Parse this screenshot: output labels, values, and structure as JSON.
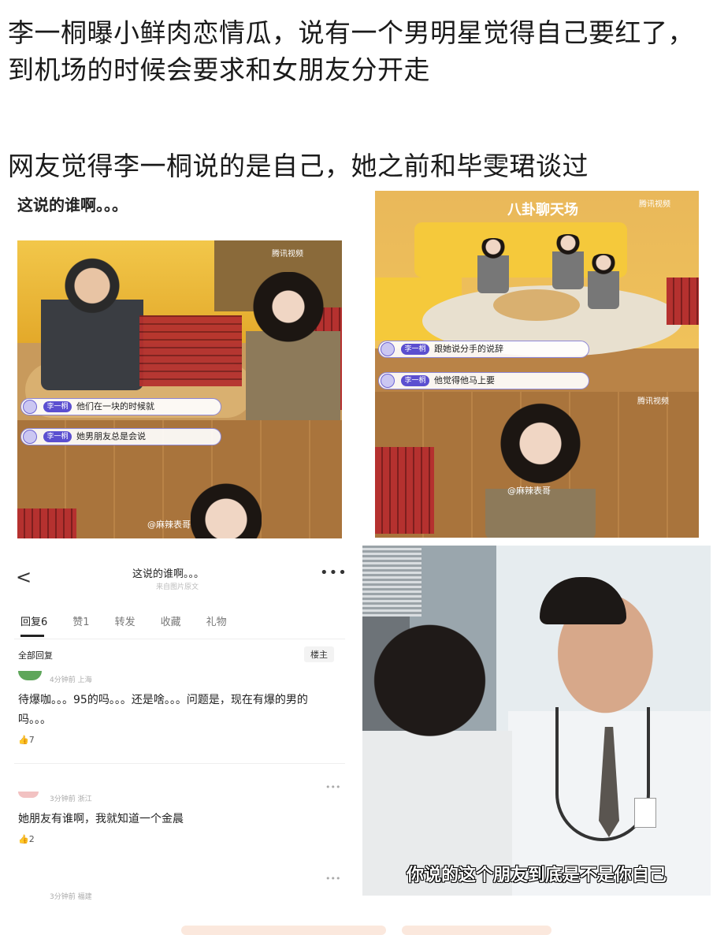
{
  "post": {
    "headline_line1": "李一桐曝小鲜肉恋情瓜，说有一个男明星觉得自己要红了，到机场的时候会要求和女朋友分开走",
    "headline_line2": "网友觉得李一桐说的是自己，她之前和毕雯珺谈过"
  },
  "shot_a": {
    "caption": "这说的谁啊。。。",
    "logo": "腾讯视频",
    "subtitle1_tag": "李一桐",
    "subtitle1_text": "他们在一块的时候就",
    "subtitle2_tag": "李一桐",
    "subtitle2_text": "她男朋友总是会说",
    "watermark": "@麻辣表哥"
  },
  "shot_b": {
    "show_title": "八卦聊天场",
    "logo": "腾讯视频",
    "subtitle1_tag": "李一桐",
    "subtitle1_text": "跟她说分手的说辞",
    "subtitle2_tag": "李一桐",
    "subtitle2_text": "他觉得他马上要",
    "watermark": "@麻辣表哥",
    "watermark2": "腾讯视频"
  },
  "shot_c": {
    "back": "<",
    "title": "这说的谁啊。。。",
    "subtitle": "来自图片原文",
    "more": "•••",
    "tabs": [
      "回复6",
      "赞1",
      "转发",
      "收藏",
      "礼物"
    ],
    "all_replies": "全部回复",
    "op_label": "楼主",
    "comments": [
      {
        "meta": "4分钟前 上海",
        "text": "待爆咖。。。95的吗。。。还是啥。。。问题是，现在有爆的男的吗。。。",
        "likes": "7"
      },
      {
        "meta": "3分钟前 浙江",
        "text": "她朋友有谁啊，我就知道一个金晨",
        "likes": "2"
      },
      {
        "meta": "3分钟前 福建",
        "text": "",
        "likes": ""
      }
    ],
    "dots": "•••"
  },
  "shot_d": {
    "subtitle": "你说的这个朋友到底是不是你自己"
  },
  "icons": {
    "like": "thumbs-up-icon",
    "back": "chevron-left-icon",
    "more": "more-icon"
  }
}
